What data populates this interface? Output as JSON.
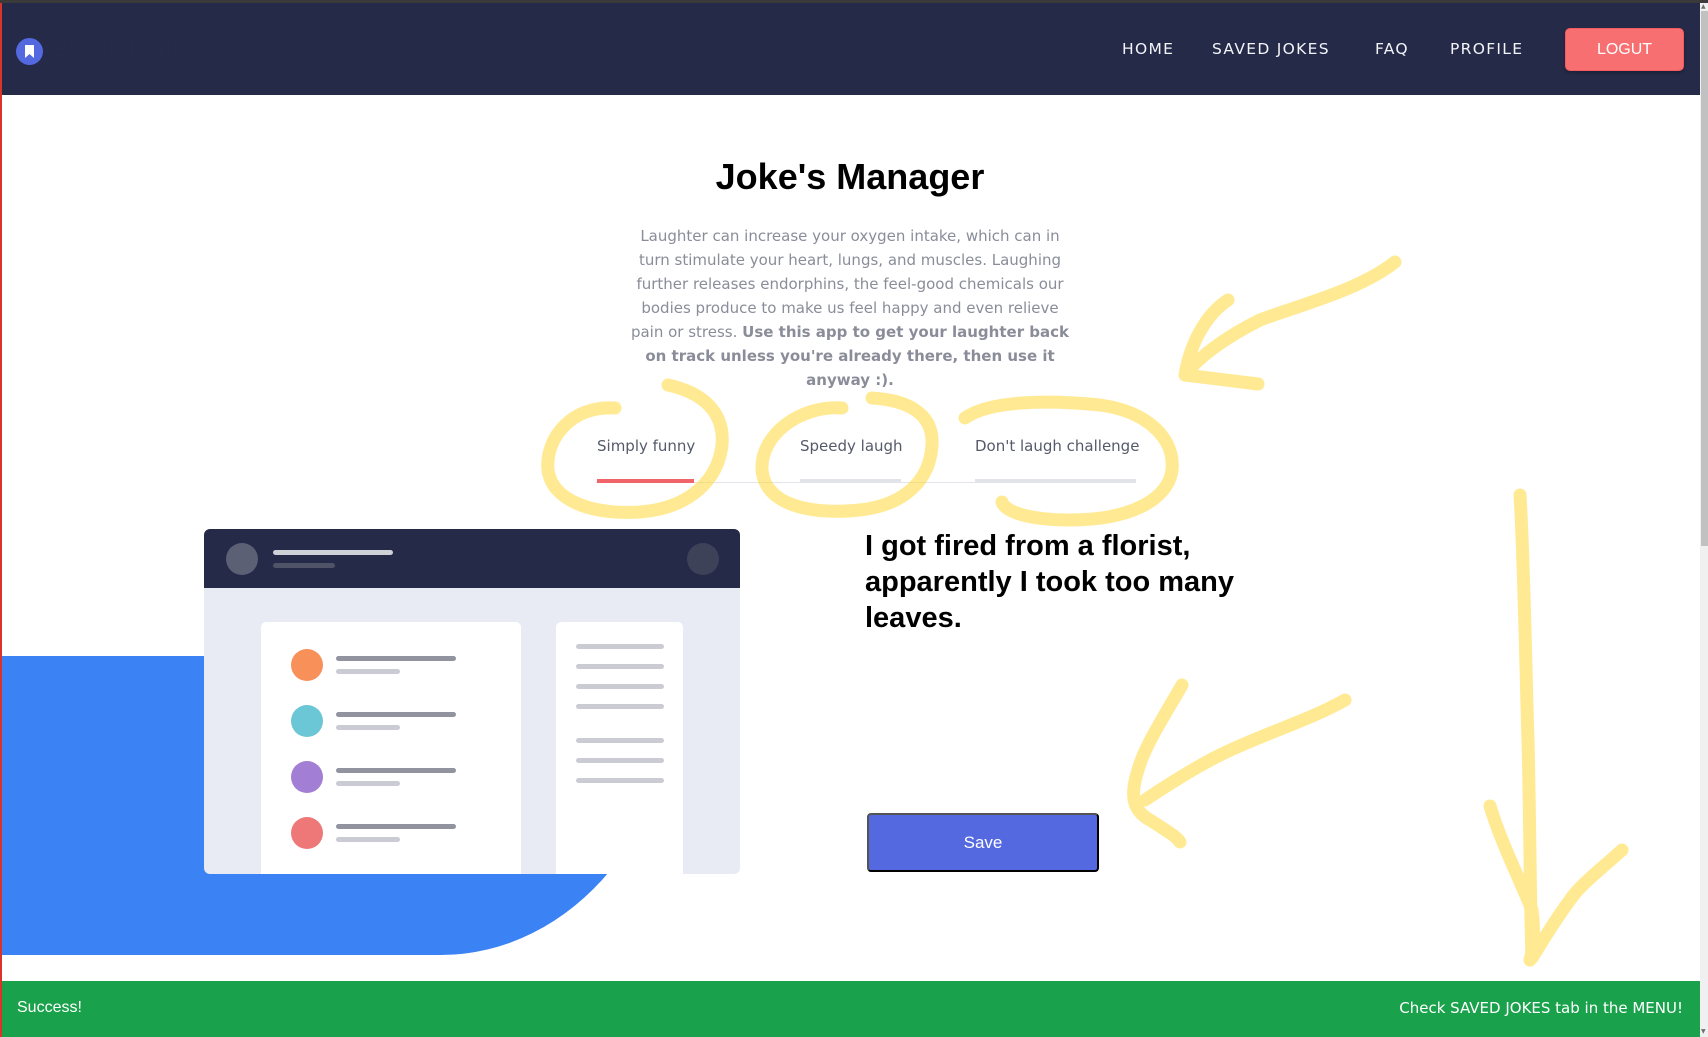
{
  "navbar": {
    "brand": "BOOKMARK",
    "links": [
      {
        "label": "HOME"
      },
      {
        "label": "SAVED JOKES"
      },
      {
        "label": "FAQ"
      },
      {
        "label": "PROFILE"
      }
    ],
    "logout_label": "LOGUT",
    "logo_icon": "bookmark-icon"
  },
  "main": {
    "title": "Joke's Manager",
    "intro_text": "Laughter can increase your oxygen intake, which can in turn stimulate your heart, lungs, and muscles. Laughing further releases endorphins, the feel-good chemicals our bodies produce to make us feel happy and even relieve pain or stress.",
    "intro_bold": "Use this app to get your laughter back on track unless you're already there, then use it anyway :).",
    "tabs": [
      {
        "label": "Simply funny",
        "active": true
      },
      {
        "label": "Speedy laugh",
        "active": false
      },
      {
        "label": "Don't laugh challenge",
        "active": false
      }
    ],
    "joke": "I got fired from a florist, apparently I took too many leaves.",
    "save_label": "Save"
  },
  "illustration": {
    "dot_colors": [
      "#f8905a",
      "#6bc6d5",
      "#a27ed5",
      "#ee7878"
    ]
  },
  "toast": {
    "left_text": "Success!",
    "right_text": "Check SAVED JOKES tab in the MENU!"
  },
  "colors": {
    "navbar": "#252a48",
    "accent": "#5468e0",
    "logout": "#f76f71",
    "success": "#19a24b",
    "active_tab": "#f0646a",
    "annotation": "#ffd83a"
  }
}
